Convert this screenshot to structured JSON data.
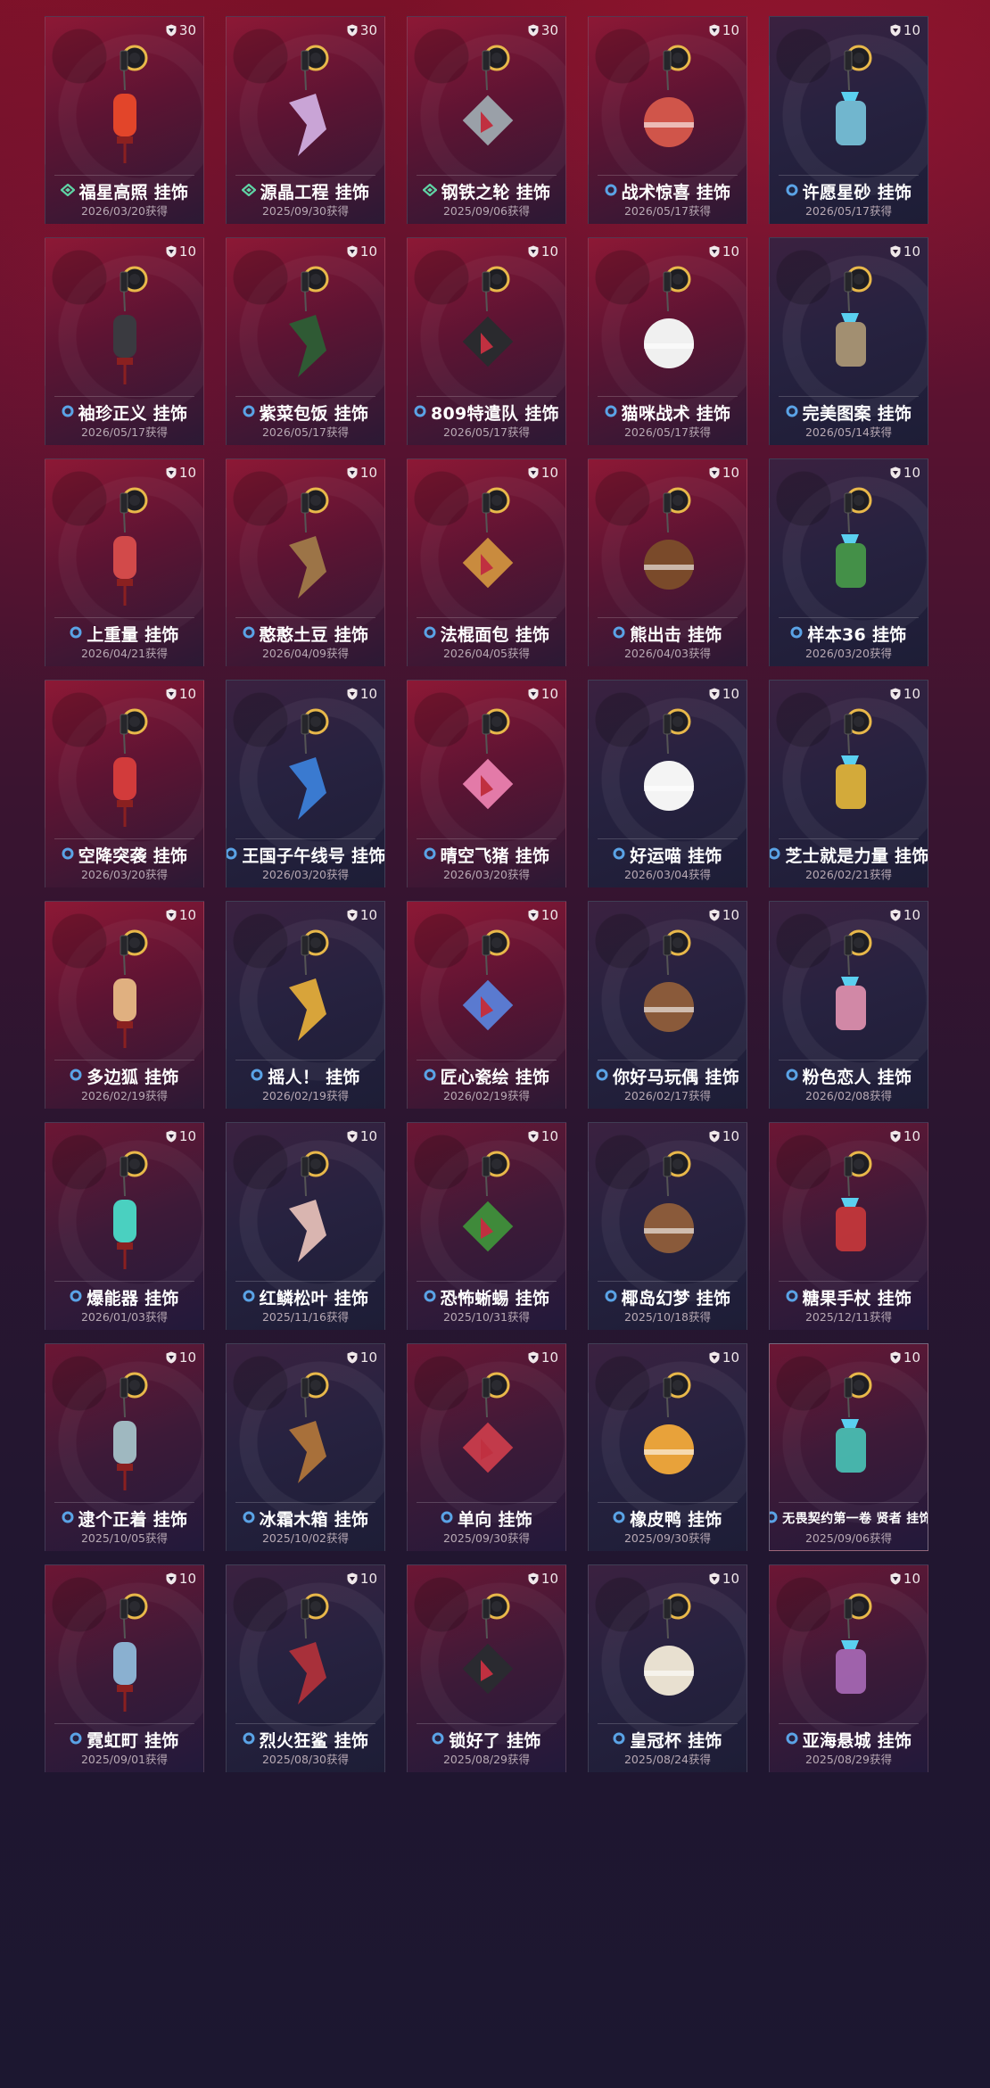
{
  "colors": {
    "tier_blue": "#5aa3e6",
    "tier_green": "#5fd3a5",
    "badge": "#f0e8ea"
  },
  "charms": [
    {
      "name": "福星高照 挂饰",
      "date": "2026/03/20获得",
      "points": "30",
      "tier": "green",
      "icon": "red-lantern-icon",
      "color": "#e2452a"
    },
    {
      "name": "源晶工程 挂饰",
      "date": "2025/09/30获得",
      "points": "30",
      "tier": "green",
      "icon": "crystal-shard-icon",
      "color": "#c9a4d6"
    },
    {
      "name": "钢铁之轮 挂饰",
      "date": "2025/09/06获得",
      "points": "30",
      "tier": "green",
      "icon": "steel-tag-icon",
      "color": "#9aa0a8"
    },
    {
      "name": "战术惊喜 挂饰",
      "date": "2026/05/17获得",
      "points": "10",
      "tier": "blue",
      "icon": "capsule-ball-icon",
      "color": "#d0554a"
    },
    {
      "name": "许愿星砂 挂饰",
      "date": "2026/05/17获得",
      "points": "10",
      "tier": "blue",
      "icon": "wish-bottle-icon",
      "color": "#7fd0e8"
    },
    {
      "name": "袖珍正义 挂饰",
      "date": "2026/05/17获得",
      "points": "10",
      "tier": "blue",
      "icon": "mini-pistol-icon",
      "color": "#3a3a40"
    },
    {
      "name": "紫菜包饭 挂饰",
      "date": "2026/05/17获得",
      "points": "10",
      "tier": "blue",
      "icon": "kimbap-icon",
      "color": "#2f5a34"
    },
    {
      "name": "809特遣队 挂饰",
      "date": "2026/05/17获得",
      "points": "10",
      "tier": "blue",
      "icon": "frying-pan-icon",
      "color": "#2a2a2e"
    },
    {
      "name": "猫咪战术 挂饰",
      "date": "2026/05/17获得",
      "points": "10",
      "tier": "blue",
      "icon": "cat-figure-icon",
      "color": "#f0f0f0"
    },
    {
      "name": "完美图案 挂饰",
      "date": "2026/05/14获得",
      "points": "10",
      "tier": "blue",
      "icon": "doll-icon",
      "color": "#b9a27a"
    },
    {
      "name": "上重量 挂饰",
      "date": "2026/04/21获得",
      "points": "10",
      "tier": "blue",
      "icon": "kettlebell-icon",
      "color": "#d24a4a"
    },
    {
      "name": "憨憨土豆 挂饰",
      "date": "2026/04/09获得",
      "points": "10",
      "tier": "blue",
      "icon": "potato-icon",
      "color": "#9c7447"
    },
    {
      "name": "法棍面包 挂饰",
      "date": "2026/04/05获得",
      "points": "10",
      "tier": "blue",
      "icon": "baguette-icon",
      "color": "#c98b3e"
    },
    {
      "name": "熊出击 挂饰",
      "date": "2026/04/03获得",
      "points": "10",
      "tier": "blue",
      "icon": "bear-icon",
      "color": "#7a4a2a"
    },
    {
      "name": "样本36 挂饰",
      "date": "2026/03/20获得",
      "points": "10",
      "tier": "blue",
      "icon": "sprout-flask-icon",
      "color": "#4aa34a"
    },
    {
      "name": "空降突袭 挂饰",
      "date": "2026/03/20获得",
      "points": "10",
      "tier": "blue",
      "icon": "scooter-icon",
      "color": "#d23b3b"
    },
    {
      "name": "王国子午线号 挂饰",
      "date": "2026/03/20获得",
      "points": "10",
      "tier": "blue",
      "icon": "ship-icon",
      "color": "#3a7ad0"
    },
    {
      "name": "晴空飞猪 挂饰",
      "date": "2026/03/20获得",
      "points": "10",
      "tier": "blue",
      "icon": "flying-pig-icon",
      "color": "#e37aa8"
    },
    {
      "name": "好运喵 挂饰",
      "date": "2026/03/04获得",
      "points": "10",
      "tier": "blue",
      "icon": "lucky-cat-icon",
      "color": "#f4f4f4"
    },
    {
      "name": "芝士就是力量 挂饰",
      "date": "2026/02/21获得",
      "points": "10",
      "tier": "blue",
      "icon": "cheese-icon",
      "color": "#f2c23a"
    },
    {
      "name": "多边狐 挂饰",
      "date": "2026/02/19获得",
      "points": "10",
      "tier": "blue",
      "icon": "poly-fox-icon",
      "color": "#e0b080"
    },
    {
      "name": "摇人！ 挂饰",
      "date": "2026/02/19获得",
      "points": "10",
      "tier": "blue",
      "icon": "bell-monkey-icon",
      "color": "#d8a43a"
    },
    {
      "name": "匠心瓷绘 挂饰",
      "date": "2026/02/19获得",
      "points": "10",
      "tier": "blue",
      "icon": "porcelain-teapot-icon",
      "color": "#5a7ad0"
    },
    {
      "name": "你好马玩偶 挂饰",
      "date": "2026/02/17获得",
      "points": "10",
      "tier": "blue",
      "icon": "horse-doll-icon",
      "color": "#8a5a3a"
    },
    {
      "name": "粉色恋人 挂饰",
      "date": "2026/02/08获得",
      "points": "10",
      "tier": "blue",
      "icon": "pink-cake-icon",
      "color": "#f09ab8"
    },
    {
      "name": "爆能器 挂饰",
      "date": "2026/01/03获得",
      "points": "10",
      "tier": "blue",
      "icon": "energy-cell-icon",
      "color": "#4ad0c0"
    },
    {
      "name": "红鳞松叶 挂饰",
      "date": "2025/11/16获得",
      "points": "10",
      "tier": "blue",
      "icon": "feather-blade-icon",
      "color": "#d9b5b0"
    },
    {
      "name": "恐怖蜥蜴 挂饰",
      "date": "2025/10/31获得",
      "points": "10",
      "tier": "blue",
      "icon": "lizard-icon",
      "color": "#3f8a3a"
    },
    {
      "name": "椰岛幻梦 挂饰",
      "date": "2025/10/18获得",
      "points": "10",
      "tier": "blue",
      "icon": "coconut-icon",
      "color": "#8a5a3a"
    },
    {
      "name": "糖果手杖 挂饰",
      "date": "2025/12/11获得",
      "points": "10",
      "tier": "blue",
      "icon": "candy-cane-icon",
      "color": "#d23b3b"
    },
    {
      "name": "逮个正着 挂饰",
      "date": "2025/10/05获得",
      "points": "10",
      "tier": "blue",
      "icon": "glass-flask-icon",
      "color": "#9fb8c0"
    },
    {
      "name": "冰霜木箱 挂饰",
      "date": "2025/10/02获得",
      "points": "10",
      "tier": "blue",
      "icon": "wooden-crate-icon",
      "color": "#a8703a"
    },
    {
      "name": "单向 挂饰",
      "date": "2025/09/30获得",
      "points": "10",
      "tier": "blue",
      "icon": "road-sign-icon",
      "color": "#c23a4a"
    },
    {
      "name": "橡皮鸭 挂饰",
      "date": "2025/09/30获得",
      "points": "10",
      "tier": "blue",
      "icon": "rubber-duck-icon",
      "color": "#e8a23a"
    },
    {
      "name": "无畏契约第一卷 贤者 挂饰",
      "date": "2025/09/06获得",
      "points": "10",
      "tier": "blue",
      "icon": "sage-figure-icon",
      "color": "#4ad0c0",
      "small": true,
      "selected": true
    },
    {
      "name": "霓虹町 挂饰",
      "date": "2025/09/01获得",
      "points": "10",
      "tier": "blue",
      "icon": "neon-city-icon",
      "color": "#8ab0d0"
    },
    {
      "name": "烈火狂鲨 挂饰",
      "date": "2025/08/30获得",
      "points": "10",
      "tier": "blue",
      "icon": "shark-icon",
      "color": "#a8303a"
    },
    {
      "name": "锁好了 挂饰",
      "date": "2025/08/29获得",
      "points": "10",
      "tier": "blue",
      "icon": "padlock-icon",
      "color": "#2a2a30"
    },
    {
      "name": "皇冠杯 挂饰",
      "date": "2025/08/24获得",
      "points": "10",
      "tier": "blue",
      "icon": "crown-cup-icon",
      "color": "#e8e0d0"
    },
    {
      "name": "亚海悬城 挂饰",
      "date": "2025/08/29获得",
      "points": "10",
      "tier": "blue",
      "icon": "floating-city-icon",
      "color": "#b070c0"
    }
  ]
}
